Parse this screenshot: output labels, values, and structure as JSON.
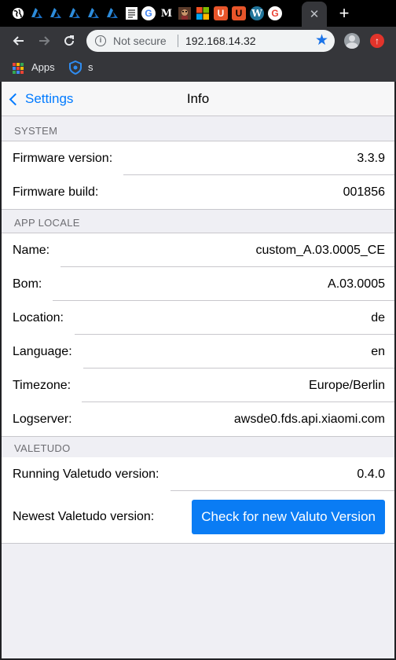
{
  "browser": {
    "tabs": [
      {
        "icon": "globe-icon"
      },
      {
        "icon": "azure-icon"
      },
      {
        "icon": "azure-icon"
      },
      {
        "icon": "azure-icon"
      },
      {
        "icon": "azure-icon"
      },
      {
        "icon": "azure-icon"
      },
      {
        "icon": "document-icon"
      },
      {
        "icon": "google-icon",
        "glyph": "G"
      },
      {
        "icon": "medium-icon",
        "glyph": "M"
      },
      {
        "icon": "character-icon"
      },
      {
        "icon": "microsoft-icon"
      },
      {
        "icon": "u-logo-icon",
        "glyph": "U"
      },
      {
        "icon": "u-logo-icon",
        "glyph": "U"
      },
      {
        "icon": "wordpress-icon",
        "glyph": "W"
      },
      {
        "icon": "google-icon",
        "glyph": "G"
      }
    ],
    "active_tab_close": "✕",
    "new_tab": "+",
    "omnibox": {
      "security_label": "Not secure",
      "url": "192.168.14.32"
    },
    "bookmarks": [
      {
        "label": "Apps",
        "icon": "apps-grid-icon"
      },
      {
        "label": "s",
        "icon": "shield-icon"
      }
    ],
    "colors": {
      "star": "#1a73e8",
      "update": "#e2342b"
    }
  },
  "navbar": {
    "back_label": "Settings",
    "title": "Info"
  },
  "sections": {
    "system": {
      "header": "SYSTEM",
      "firmware_version_label": "Firmware version:",
      "firmware_version": "3.3.9",
      "firmware_build_label": "Firmware build:",
      "firmware_build": "001856"
    },
    "app_locale": {
      "header": "APP LOCALE",
      "name_label": "Name:",
      "name": "custom_A.03.0005_CE",
      "bom_label": "Bom:",
      "bom": "A.03.0005",
      "location_label": "Location:",
      "location": "de",
      "language_label": "Language:",
      "language": "en",
      "timezone_label": "Timezone:",
      "timezone": "Europe/Berlin",
      "logserver_label": "Logserver:",
      "logserver": "awsde0.fds.api.xiaomi.com"
    },
    "valetudo": {
      "header": "VALETUDO",
      "running_label": "Running Valetudo version:",
      "running_version": "0.4.0",
      "newest_label": "Newest Valetudo version:",
      "check_button": "Check for new Valuto Version"
    }
  },
  "colors": {
    "accent": "#007aff",
    "button": "#0a7cf4",
    "page_bg": "#efeff4"
  }
}
